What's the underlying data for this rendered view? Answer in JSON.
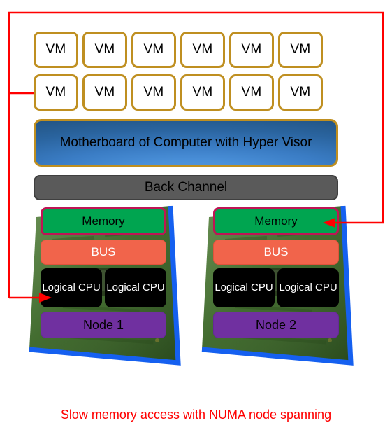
{
  "diagram": {
    "title": "Slow memory access with NUMA node spanning",
    "caption": "Slow memory access with NUMA node spanning",
    "colors": {
      "vm_border": "#bf8f20",
      "vm_fill": "#ffffff",
      "motherboard_dark": "#1f4e79",
      "motherboard_light": "#4a90d9",
      "motherboard_border": "#bf8f20",
      "back_channel_fill": "#5a5a5a",
      "memory_fill": "#00a550",
      "memory_border": "#bf1555",
      "bus_fill": "#f1644b",
      "cpu_fill": "#000000",
      "node_fill": "#7030a0",
      "board_green": "#3f6b2b",
      "board_edge_blue": "#1560f0",
      "arrow_red": "#ff0000",
      "caption_red": "#ff0000"
    }
  },
  "vms": {
    "row_top": [
      {
        "label": "VM"
      },
      {
        "label": "VM"
      },
      {
        "label": "VM"
      },
      {
        "label": "VM"
      },
      {
        "label": "VM"
      },
      {
        "label": "VM"
      }
    ],
    "row_bottom": [
      {
        "label": "VM"
      },
      {
        "label": "VM"
      },
      {
        "label": "VM"
      },
      {
        "label": "VM"
      },
      {
        "label": "VM"
      },
      {
        "label": "VM"
      }
    ]
  },
  "motherboard": {
    "label": "Motherboard of Computer with Hyper Visor"
  },
  "back_channel": {
    "label": "Back Channel"
  },
  "nodes": [
    {
      "memory_label": "Memory",
      "bus_label": "BUS",
      "cpu_left_label": "Logical CPU",
      "cpu_right_label": "Logical CPU",
      "node_label": "Node 1"
    },
    {
      "memory_label": "Memory",
      "bus_label": "BUS",
      "cpu_left_label": "Logical CPU",
      "cpu_right_label": "Logical CPU",
      "node_label": "Node 2"
    }
  ]
}
